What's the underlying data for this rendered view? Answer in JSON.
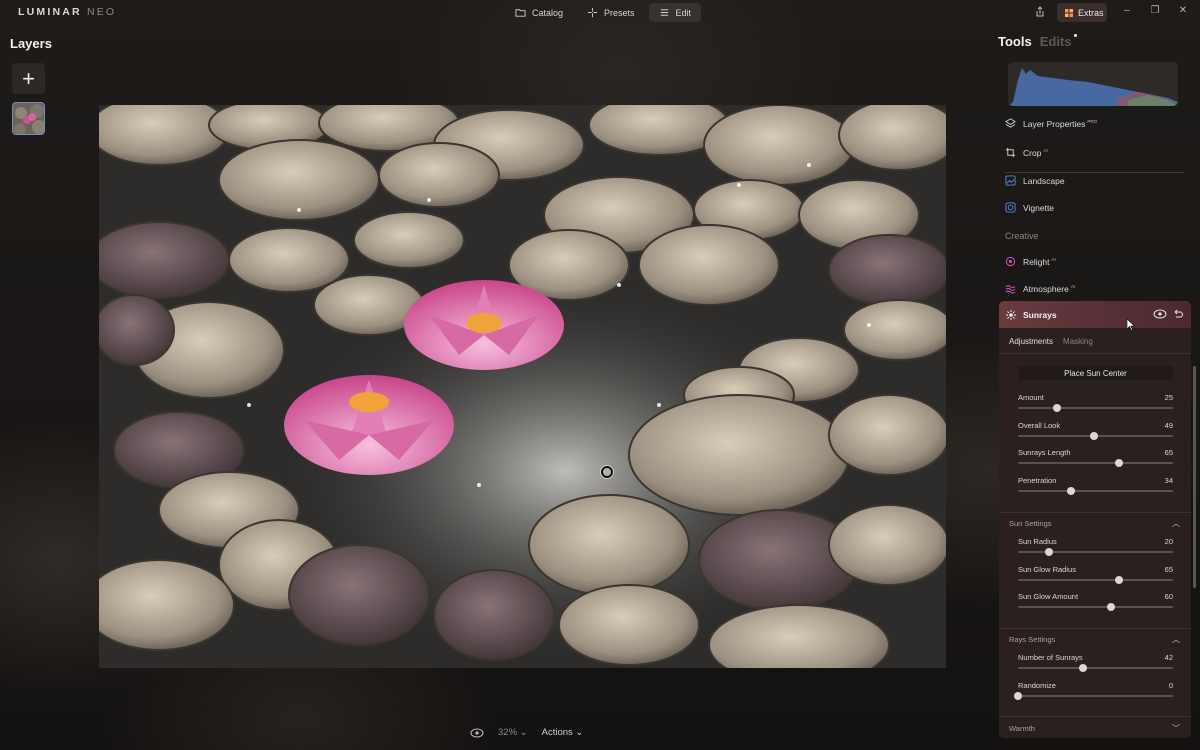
{
  "app": {
    "logo_main": "LUMINAR",
    "logo_sub": "NEO"
  },
  "nav": {
    "tabs": [
      {
        "label": "Catalog",
        "icon": "folder-icon"
      },
      {
        "label": "Presets",
        "icon": "sparkle-icon"
      },
      {
        "label": "Edit",
        "icon": "sliders-icon",
        "active": true
      }
    ],
    "extras_label": "Extras"
  },
  "left": {
    "title": "Layers",
    "add_label": "+"
  },
  "bottom": {
    "zoom": "32%",
    "actions_label": "Actions"
  },
  "right": {
    "tabs": [
      {
        "label": "Tools",
        "active": true
      },
      {
        "label": "Edits"
      }
    ],
    "tools": [
      {
        "label": "Layer Properties",
        "badge": "PRO",
        "icon": "layers-icon"
      },
      {
        "label": "Crop",
        "badge": "AI",
        "icon": "crop-icon"
      },
      {
        "label": "Landscape",
        "badge": "",
        "icon": "landscape-icon"
      },
      {
        "label": "Vignette",
        "badge": "",
        "icon": "vignette-icon"
      }
    ],
    "section_creative": "Creative",
    "creative_tools": [
      {
        "label": "Relight",
        "badge": "AI",
        "icon": "relight-icon"
      },
      {
        "label": "Atmosphere",
        "badge": "AI",
        "icon": "atmosphere-icon"
      }
    ],
    "sunrays": {
      "title": "Sunrays",
      "subtabs": [
        {
          "label": "Adjustments",
          "active": true
        },
        {
          "label": "Masking"
        }
      ],
      "place_button": "Place Sun Center",
      "sliders": [
        {
          "label": "Amount",
          "value": "25",
          "level": 0.25
        },
        {
          "label": "Overall Look",
          "value": "49",
          "level": 0.49
        },
        {
          "label": "Sunrays Length",
          "value": "65",
          "level": 0.65
        },
        {
          "label": "Penetration",
          "value": "34",
          "level": 0.34
        }
      ],
      "sun_settings_title": "Sun Settings",
      "sun_sliders": [
        {
          "label": "Sun Radius",
          "value": "20",
          "level": 0.2
        },
        {
          "label": "Sun Glow Radius",
          "value": "65",
          "level": 0.65
        },
        {
          "label": "Sun Glow Amount",
          "value": "60",
          "level": 0.6
        }
      ],
      "rays_settings_title": "Rays Settings",
      "rays_sliders": [
        {
          "label": "Number of Sunrays",
          "value": "42",
          "level": 0.42
        },
        {
          "label": "Randomize",
          "value": "0",
          "level": 0.0
        }
      ],
      "warmth_title": "Warmth"
    }
  },
  "colors": {
    "accent_purple": "#c9a9ff",
    "ai_badge": "#ff9a7a",
    "sunrays_header": "#6b3a3d",
    "histogram_blue": "#4b6fb0"
  }
}
